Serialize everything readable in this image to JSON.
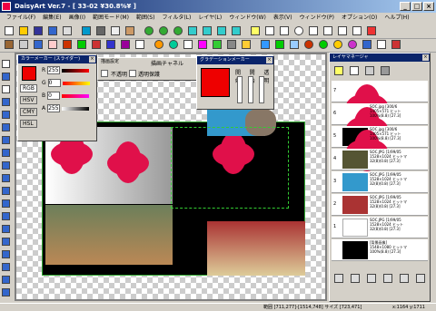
{
  "title": "DaisyArt Ver.7 - [ 33-02 ¥30.8%¥ ]",
  "menu": [
    "ファイル(F)",
    "編集(E)",
    "画像(I)",
    "範囲モード(M)",
    "範囲(S)",
    "フィルタ(L)",
    "レイヤ(L)",
    "ウィンドウ(W)",
    "表示(V)",
    "ウィンドウ(P)",
    "オプション(O)",
    "ヘルプ(H)"
  ],
  "color_dialog": {
    "title": "カラーメーカー (スライダー)",
    "labels": [
      "R",
      "G",
      "B",
      "A"
    ],
    "values": [
      "255",
      "0",
      "0",
      "255"
    ],
    "modes": [
      "RGB",
      "HSV",
      "CMY",
      "HSL"
    ]
  },
  "blend_dialog": {
    "title": "描画設定",
    "sub": "描画チャネル",
    "labels": [
      "不透明",
      "透明保護"
    ]
  },
  "grad_dialog": {
    "title": "グラデーションメーカー",
    "labels": [
      "開始",
      "開始",
      "透明"
    ]
  },
  "layer_window": {
    "title": "レイヤマネージャ",
    "layers": [
      {
        "num": "7",
        "info": ""
      },
      {
        "num": "6",
        "info": "SOC.jpg [300/6\n1405×571 ヒット\n100%(8.8) [27.3]"
      },
      {
        "num": "5",
        "info": "SOC.jpg [300/6\n1405×571 ヒット\n100%(8.8) [27.3]"
      },
      {
        "num": "4",
        "info": "SOC.JPG [1/99/05\n1528×1024 ヒットマ\n32(8)(0.8) [27.3]"
      },
      {
        "num": "3",
        "info": "SOC.JPG [1/99/05\n1528×1024 ヒットマ\n32(8)(0.8) [27.3]"
      },
      {
        "num": "2",
        "info": "SOC.JPG [1/99/05\n1528×1024 ヒットマ\n32(8)(0.8) [27.3]"
      },
      {
        "num": "1",
        "info": "SOC.JPG [1/99/05\n1528×1024 ヒット\n32(8)(0.8) [27.3]"
      },
      {
        "num": "",
        "info": "[背景画像]\n1548×1080 ヒットマ\n100%(8.8) [27.3]"
      }
    ]
  },
  "status": {
    "left": "範囲 [711,277]-[1514,748] サイズ [723,471]",
    "right": "x:1164 y:1711"
  },
  "colors": {
    "accent": "#0a246a",
    "flower": "#e0104a"
  }
}
